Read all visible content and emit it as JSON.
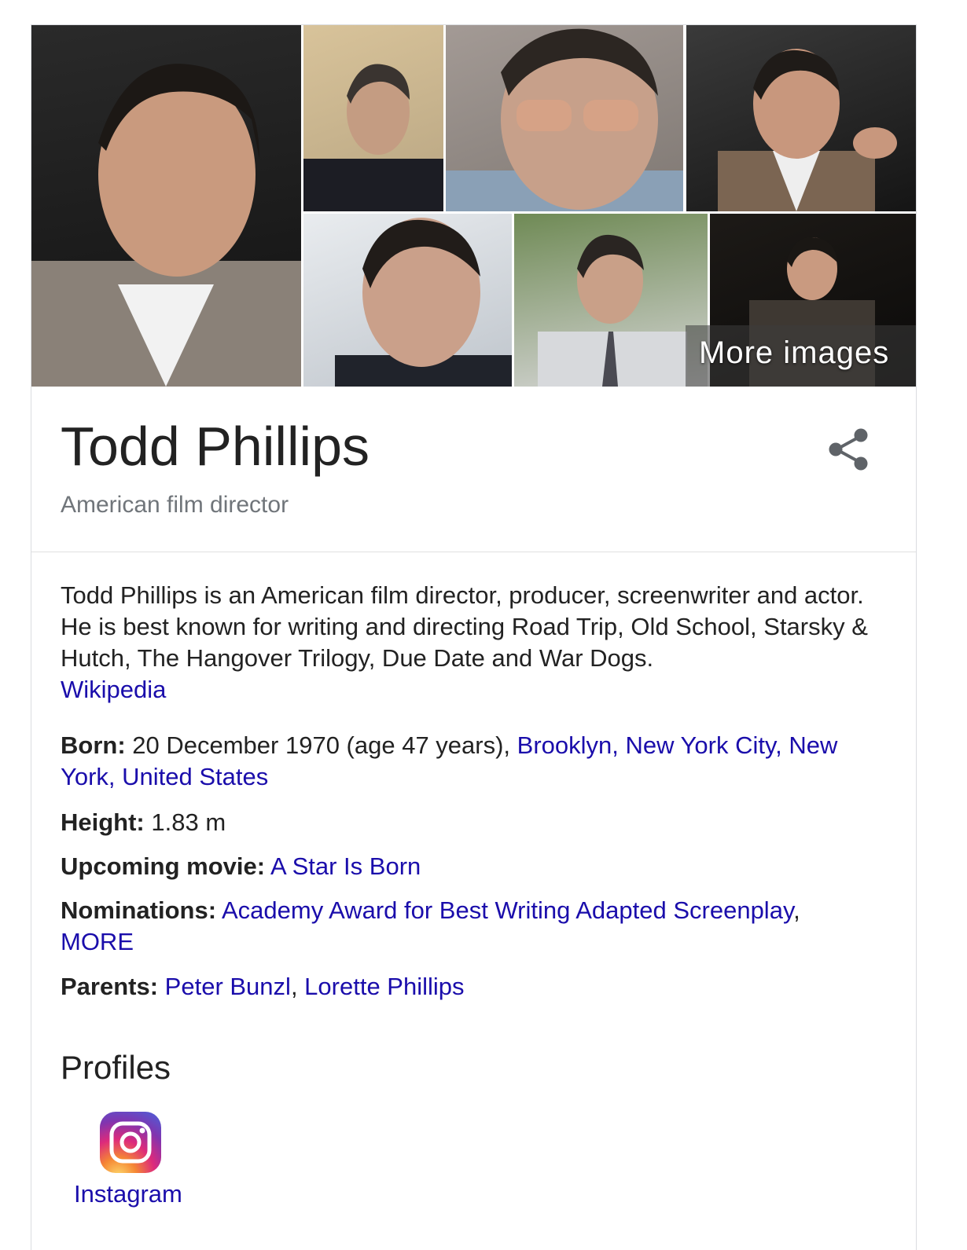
{
  "images": {
    "more_label": "More images"
  },
  "person": {
    "name": "Todd Phillips",
    "subtitle": "American film director"
  },
  "description": {
    "text": "Todd Phillips is an American film director, producer, screenwriter and actor. He is best known for writing and directing Road Trip, Old School, Starsky & Hutch, The Hangover Trilogy, Due Date and War Dogs.",
    "source_link": "Wikipedia"
  },
  "facts": {
    "born": {
      "label": "Born:",
      "value": " 20 December 1970 (age 47 years), ",
      "place_link": "Brooklyn, New York City, New York, United States"
    },
    "height": {
      "label": "Height:",
      "value": " 1.83 m"
    },
    "upcoming": {
      "label": "Upcoming movie:",
      "movie_link": "A Star Is Born"
    },
    "nominations": {
      "label": "Nominations:",
      "award_link": "Academy Award for Best Writing Adapted Screenplay",
      "separator": ",",
      "more_link": "MORE"
    },
    "parents": {
      "label": "Parents:",
      "parent1_link": "Peter Bunzl",
      "separator": ", ",
      "parent2_link": "Lorette Phillips"
    }
  },
  "profiles": {
    "title": "Profiles",
    "items": [
      {
        "label": "Instagram",
        "icon": "instagram-icon"
      }
    ]
  },
  "colors": {
    "link": "#1a0dab",
    "text": "#222222",
    "muted": "#70757a"
  }
}
